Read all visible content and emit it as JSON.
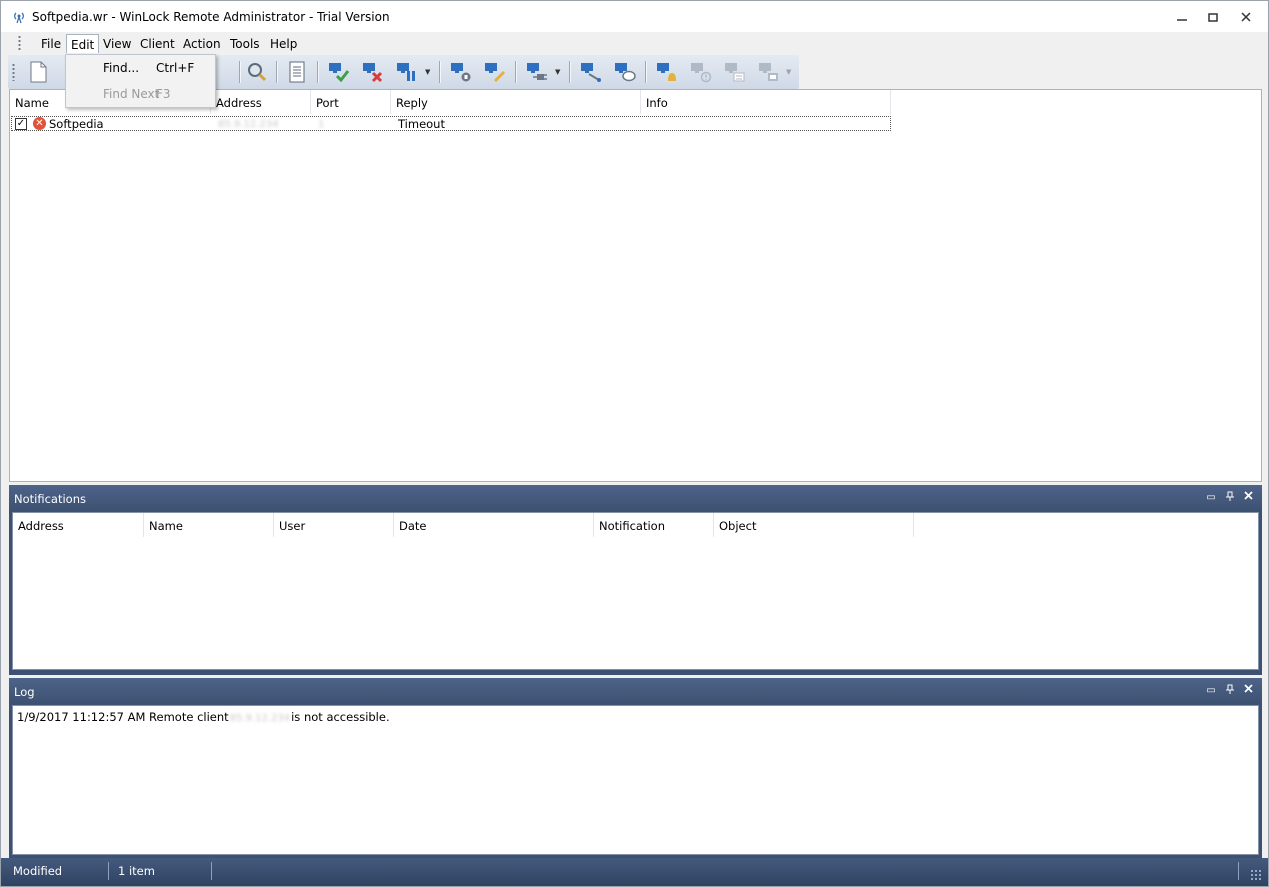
{
  "window": {
    "title": "Softpedia.wr - WinLock Remote Administrator - Trial Version"
  },
  "menu": {
    "items": [
      "File",
      "Edit",
      "View",
      "Client",
      "Action",
      "Tools",
      "Help"
    ],
    "active": "Edit"
  },
  "edit_menu": {
    "find": {
      "label": "Find...",
      "shortcut": "Ctrl+F"
    },
    "find_next": {
      "label": "Find Next",
      "shortcut": "F3",
      "enabled": false
    }
  },
  "toolbar": {
    "icons": [
      "new-document-icon",
      "search-icon",
      "report-icon",
      "connect-icon",
      "disconnect-icon",
      "pause-icon",
      "lock-icon",
      "edit-icon",
      "plug-icon",
      "network-icon",
      "message-icon",
      "alert-icon",
      "warning-icon",
      "list-icon",
      "screen-icon"
    ]
  },
  "client_list": {
    "columns": [
      "Name",
      "Address",
      "Port",
      "Reply",
      "Info"
    ],
    "rows": [
      {
        "checked": true,
        "status": "error",
        "name": "Softpedia",
        "address": "85.9.12.234",
        "port": "1",
        "reply": "Timeout",
        "info": ""
      }
    ]
  },
  "notifications": {
    "title": "Notifications",
    "columns": [
      "Address",
      "Name",
      "User",
      "Date",
      "Notification",
      "Object"
    ]
  },
  "log": {
    "title": "Log",
    "entry_prefix": "1/9/2017 11:12:57 AM Remote client",
    "entry_blurred": "85.9.12.234",
    "entry_suffix": "is not accessible."
  },
  "status": {
    "state": "Modified",
    "count": "1 item"
  },
  "colors": {
    "panel_header": "#3d5172",
    "error": "#e0533b",
    "toolbar_blue": "#2f6fbf"
  }
}
